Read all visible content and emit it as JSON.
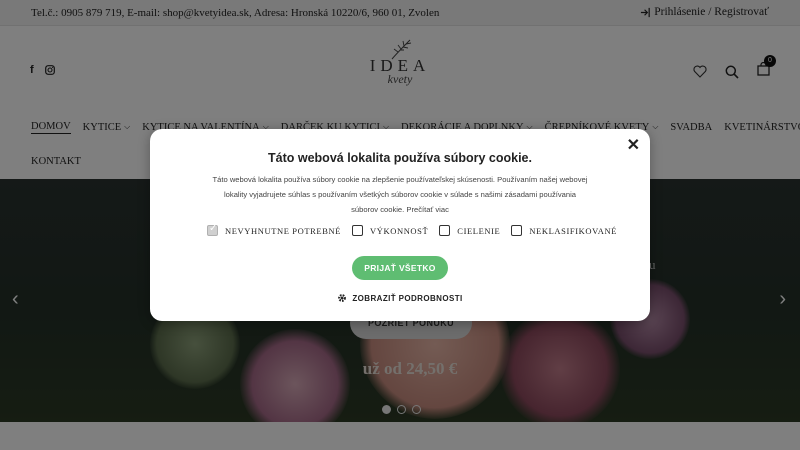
{
  "topbar": {
    "contact": "Tel.č.: 0905 879 719, E-mail: shop@kvetyidea.sk, Adresa: Hronská 10220/6, 960 01, Zvolen",
    "login": "Prihlásenie / Registrovať"
  },
  "header": {
    "social": [
      "facebook-icon",
      "instagram-icon"
    ],
    "logo_word": "IDEA",
    "logo_script": "kvety",
    "cart_count": "0"
  },
  "nav": {
    "row1": [
      {
        "label": "DOMOV",
        "dropdown": false,
        "active": true
      },
      {
        "label": "KYTICE",
        "dropdown": true
      },
      {
        "label": "KYTICE NA VALENTÍNA",
        "dropdown": true
      },
      {
        "label": "DARČEK KU KYTICI",
        "dropdown": true
      },
      {
        "label": "DEKORÁCIE A DOPLNKY",
        "dropdown": true
      },
      {
        "label": "ČREPNÍKOVÉ KVETY",
        "dropdown": true
      },
      {
        "label": "SVADBA",
        "dropdown": false
      },
      {
        "label": "KVETINÁRSTVO",
        "dropdown": false
      }
    ],
    "row2": [
      {
        "label": "KONTAKT",
        "dropdown": false
      }
    ]
  },
  "hero": {
    "partial_text": "u",
    "cta": "POZRIEŤ PONUKU",
    "price": "už od 24,50 €",
    "slides": 3,
    "active_slide": 1
  },
  "cookie": {
    "title": "Táto webová lokalita používa súbory cookie.",
    "description": "Táto webová lokalita používa súbory cookie na zlepšenie používateľskej skúsenosti. Používaním našej webovej lokality vyjadrujete súhlas s používaním všetkých súborov cookie v súlade s našimi zásadami používania súborov cookie. Prečítať viac",
    "options": [
      {
        "label": "NEVYHNUTNE POTREBNÉ",
        "checked": true,
        "disabled": true
      },
      {
        "label": "VÝKONNOSŤ",
        "checked": false
      },
      {
        "label": "CIELENIE",
        "checked": false
      },
      {
        "label": "NEKLASIFIKOVANÉ",
        "checked": false
      }
    ],
    "accept_label": "PRIJAŤ VŠETKO",
    "details_label": "ZOBRAZIŤ PODROBNOSTI",
    "accent_color": "#5fbd72"
  }
}
